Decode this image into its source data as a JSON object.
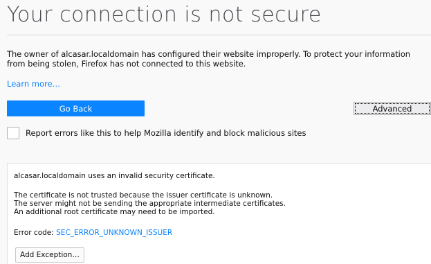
{
  "title": "Your connection is not secure",
  "description": {
    "line1": "The owner of alcasar.localdomain has configured their website improperly. To protect your information",
    "line2": "from being stolen, Firefox has not connected to this website."
  },
  "learn_more": "Learn more…",
  "buttons": {
    "go_back": "Go Back",
    "advanced": "Advanced",
    "add_exception": "Add Exception…"
  },
  "report_checkbox": {
    "label": "Report errors like this to help Mozilla identify and block malicious sites",
    "checked": false
  },
  "details": {
    "summary": "alcasar.localdomain uses an invalid security certificate.",
    "reasons": [
      "The certificate is not trusted because the issuer certificate is unknown.",
      "The server might not be sending the appropriate intermediate certificates.",
      "An additional root certificate may need to be imported."
    ],
    "error_code_label": "Error code:",
    "error_code": "SEC_ERROR_UNKNOWN_ISSUER"
  },
  "colors": {
    "accent": "#0a84ff",
    "background": "#f9f9fa",
    "title": "#4a4a4f"
  }
}
